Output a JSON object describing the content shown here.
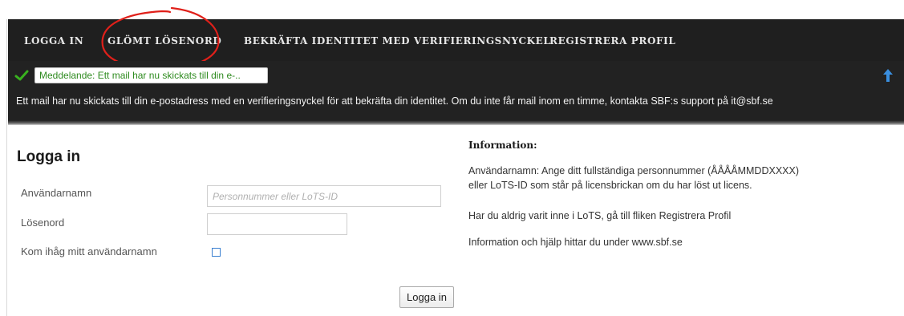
{
  "nav": {
    "items": [
      {
        "label": "LOGGA IN"
      },
      {
        "label": "GLÖMT LÖSENORD"
      },
      {
        "label": "BEKRÄFTA IDENTITET MED VERIFIERINGSNYCKEL"
      },
      {
        "label": "REGISTRERA PROFIL"
      }
    ]
  },
  "message": {
    "notice": "Meddelande: Ett mail har nu skickats till din e-..",
    "body": "Ett mail har nu skickats till din e-postadress med en verifieringsnyckel för att bekräfta din identitet. Om du inte får mail inom en timme, kontakta SBF:s support på it@sbf.se"
  },
  "login": {
    "title": "Logga in",
    "username_label": "Användarnamn",
    "username_placeholder": "Personnummer eller LoTS-ID",
    "username_value": "",
    "password_label": "Lösenord",
    "password_value": "",
    "remember_label": "Kom ihåg mitt användarnamn",
    "remember_checked": false,
    "submit_label": "Logga in"
  },
  "info": {
    "title": "Information:",
    "line1": "Användarnamn: Ange ditt fullständiga personnummer (ÅÅÅÅMMDDXXXX)",
    "line2": "eller LoTS-ID som står på licensbrickan om du har löst ut licens.",
    "line3": "Har du aldrig varit inne i LoTS, gå till fliken Registrera Profil",
    "line4": "Information och hjälp hittar du under www.sbf.se"
  },
  "colors": {
    "navbar": "#1f1f1f",
    "notice_text": "#2e8b1f",
    "check": "#39b21f",
    "arrow": "#3a8fe0",
    "annotation": "#e0201a"
  },
  "icons": [
    "check-icon",
    "arrow-up-icon"
  ]
}
